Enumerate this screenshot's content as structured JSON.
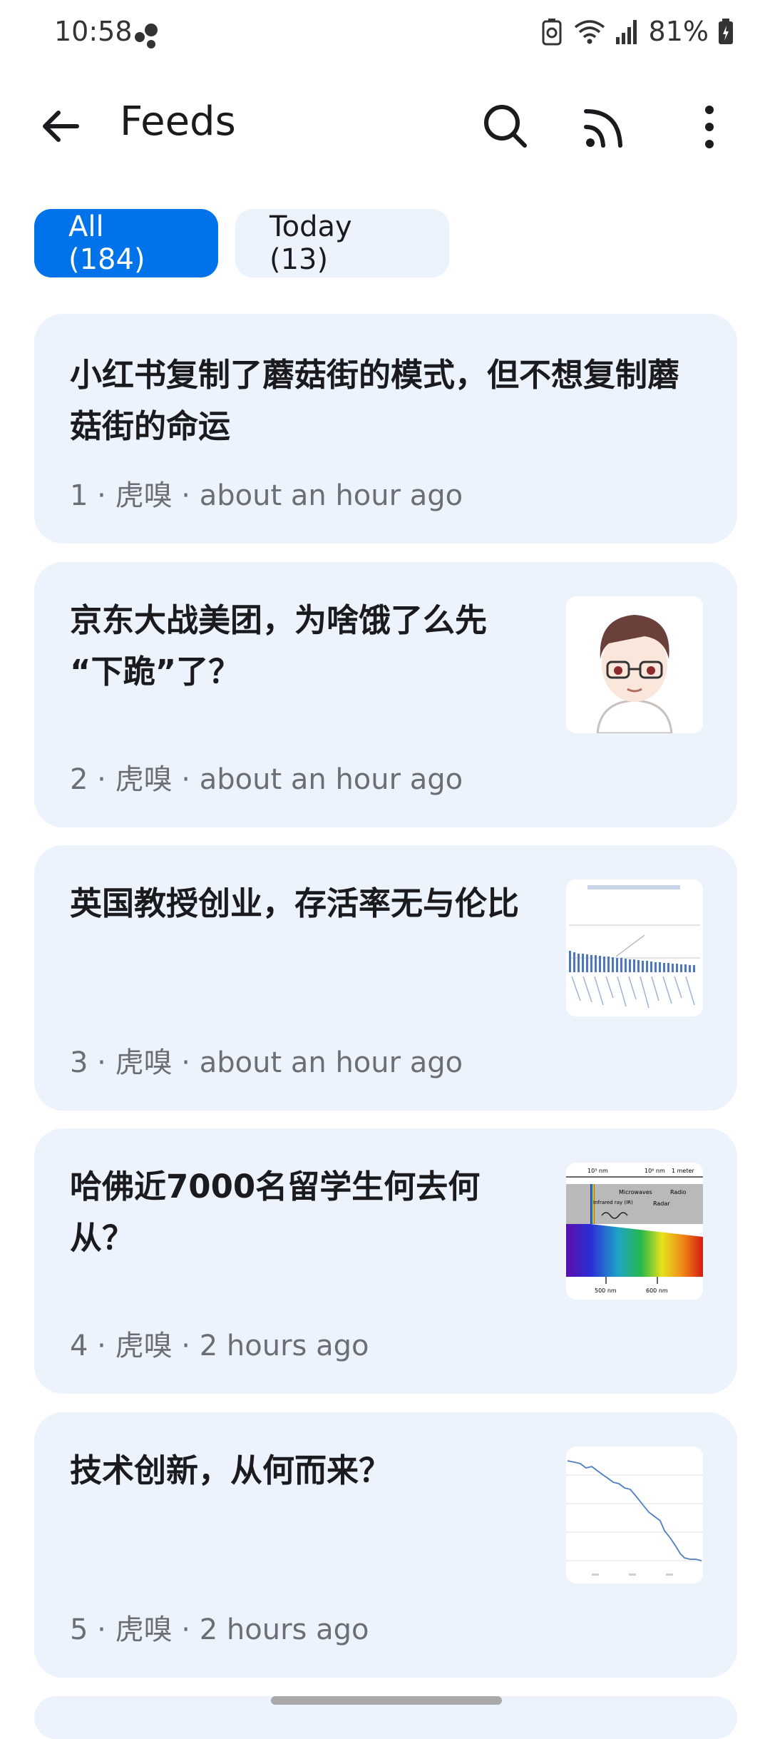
{
  "status_bar": {
    "time": "10:58",
    "battery_percent": "81%",
    "icons": [
      "dots-icon",
      "recycle-battery-icon",
      "wifi-icon",
      "signal-icon",
      "battery-icon"
    ]
  },
  "app_bar": {
    "title": "Feeds",
    "icons": [
      "back-arrow-icon",
      "search-icon",
      "rss-icon",
      "more-vert-icon"
    ]
  },
  "filters": {
    "all": "All (184)",
    "today": "Today (13)"
  },
  "feed": [
    {
      "title_line1": "小红书复制了蘑菇街的模式，但不想复制蘑",
      "title_line2": "菇街的命运",
      "meta": "1 · 虎嗅 · about an hour ago"
    },
    {
      "title_line1": "京东大战美团，为啥饿了么先",
      "title_line2": "“下跪”了？",
      "meta": "2 · 虎嗅 · about an hour ago",
      "thumbnail": "avatar-illustration"
    },
    {
      "title_line1": "英国教授创业，存活率无与伦比",
      "title_line2": "",
      "meta": "3 · 虎嗅 · about an hour ago",
      "thumbnail": "bar-chart-image"
    },
    {
      "title_line1": "哈佛近7000名留学生何去何",
      "title_line2": "从？",
      "meta": "4 · 虎嗅 · 2 hours ago",
      "thumbnail": "spectrum-diagram-image",
      "thumbnail_labels": [
        "10³ nm",
        "10⁶ nm",
        "1 meter",
        "Microwaves",
        "Radio",
        "Infrared ray (IR)",
        "Radar",
        "500 nm",
        "600 nm"
      ]
    },
    {
      "title_line1": "技术创新，从何而来？",
      "title_line2": "",
      "meta": "5 · 虎嗅 · 2 hours ago",
      "thumbnail": "line-chart-image"
    }
  ],
  "colors": {
    "accent": "#0073ea",
    "card_bg": "#edf3fd",
    "meta_text": "#6b6e75"
  }
}
